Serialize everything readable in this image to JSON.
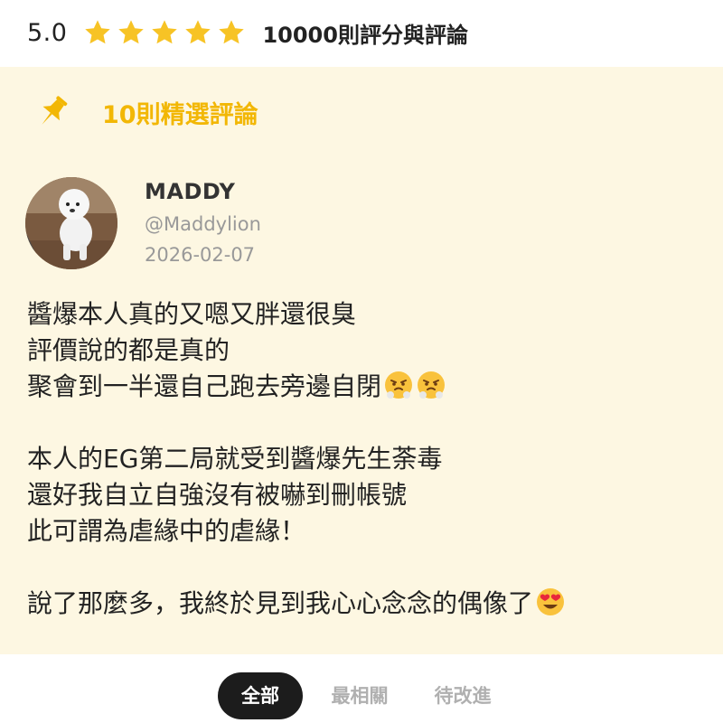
{
  "rating": {
    "value": "5.0",
    "stars": 5,
    "max_stars": 5,
    "count_label": "10000則評分與評論",
    "star_color": "#f7c325"
  },
  "featured": {
    "label": "10則精選評論",
    "accent_color": "#f2b705",
    "icon": "pin-icon"
  },
  "review": {
    "name": "MADDY",
    "handle": "@Maddylion",
    "date": "2026-02-07",
    "lines": [
      "醬爆本人真的又嗯又胖還很臭",
      "評價說的都是真的",
      "聚會到一半還自己跑去旁邊自閉",
      "",
      "本人的EG第二局就受到醬爆先生荼毒",
      "還好我自立自強沒有被嚇到刪帳號",
      "此可謂為虐緣中的虐緣！",
      "",
      "說了那麼多，我終於見到我心心念念的偶像了"
    ],
    "emojis": {
      "line_3": [
        "steam-from-nose-emoji",
        "steam-from-nose-emoji"
      ],
      "line_9": [
        "heart-eyes-emoji"
      ]
    }
  },
  "tabs": [
    {
      "label": "全部",
      "selected": true
    },
    {
      "label": "最相關",
      "selected": false
    },
    {
      "label": "待改進",
      "selected": false
    }
  ],
  "colors": {
    "panel_background": "#fdf7e2",
    "tab_selected_background": "#1c1c1c"
  }
}
